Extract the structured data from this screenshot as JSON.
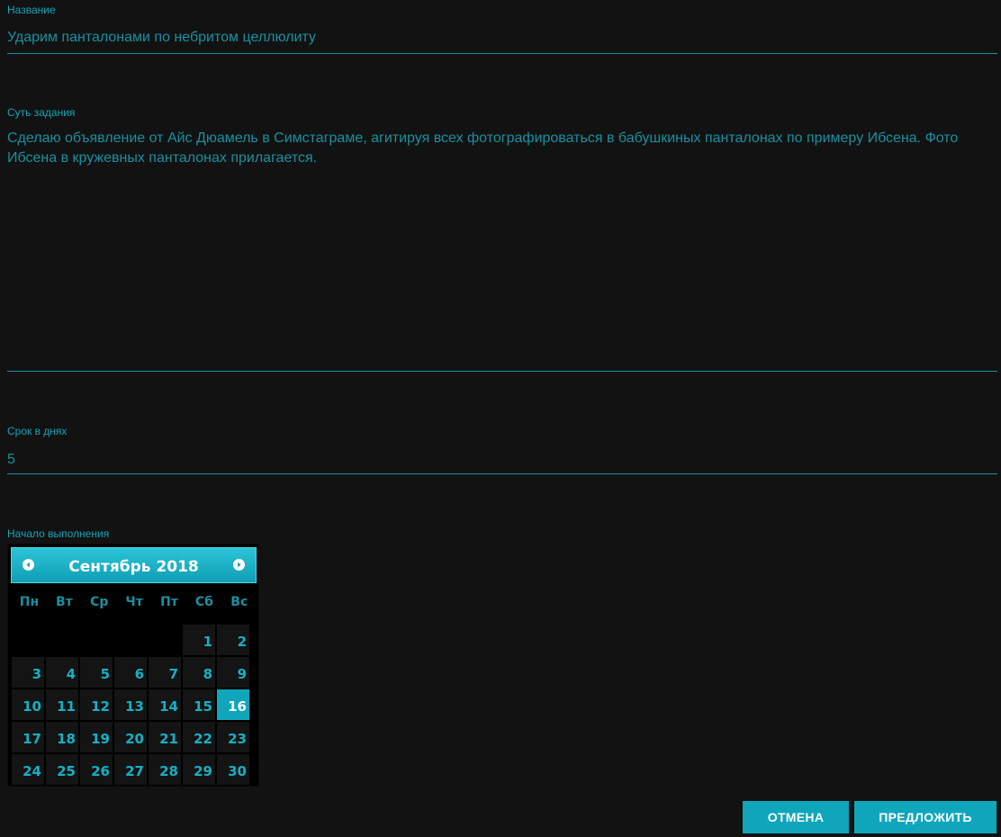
{
  "form": {
    "title": {
      "label": "Название",
      "value": "Ударим панталонами по небритом целлюлиту"
    },
    "description": {
      "label": "Суть задания",
      "value": "Сделаю объявление от Айс Дюамель в Симстаграме, агитируя всех фотографироваться в бабушкиных панталонах по примеру Ибсена. Фото Ибсена в кружевных панталонах прилагается."
    },
    "duration": {
      "label": "Срок в днях",
      "value": "5"
    },
    "start": {
      "label": "Начало выполнения"
    }
  },
  "calendar": {
    "title": "Сентябрь 2018",
    "weekdays": [
      "Пн",
      "Вт",
      "Ср",
      "Чт",
      "Пт",
      "Сб",
      "Вс"
    ],
    "leading_blanks": 5,
    "days_in_month": 30,
    "selected_day": 16,
    "prev_icon": "chevron-left-icon",
    "next_icon": "chevron-right-icon"
  },
  "actions": {
    "cancel_label": "ОТМЕНА",
    "submit_label": "ПРЕДЛОЖИТЬ"
  },
  "colors": {
    "background": "#121212",
    "accent": "#0fa6bc",
    "text": "#1a8fa0"
  }
}
